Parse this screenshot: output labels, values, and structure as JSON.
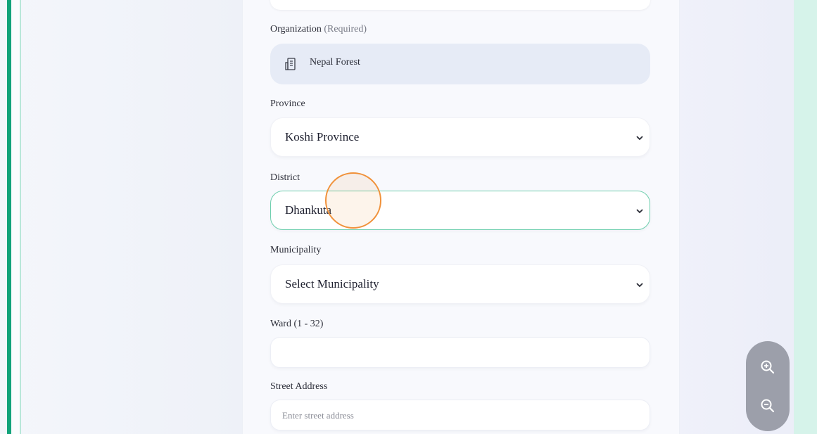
{
  "form": {
    "organization": {
      "label": "Organization",
      "required_note": "(Required)",
      "value": "Nepal Forest"
    },
    "province": {
      "label": "Province",
      "value": "Koshi Province"
    },
    "district": {
      "label": "District",
      "value": "Dhankuta"
    },
    "municipality": {
      "label": "Municipality",
      "value": "Select Municipality"
    },
    "ward": {
      "label": "Ward (1 - 32)",
      "value": ""
    },
    "street": {
      "label": "Street Address",
      "placeholder": "Enter street address"
    }
  },
  "zoom": {
    "in_icon": "zoom-in-icon",
    "out_icon": "zoom-out-icon"
  },
  "colors": {
    "accent_green": "#12a37a",
    "focus_border": "#6fcfae",
    "cursor_ring": "#f0913a"
  }
}
